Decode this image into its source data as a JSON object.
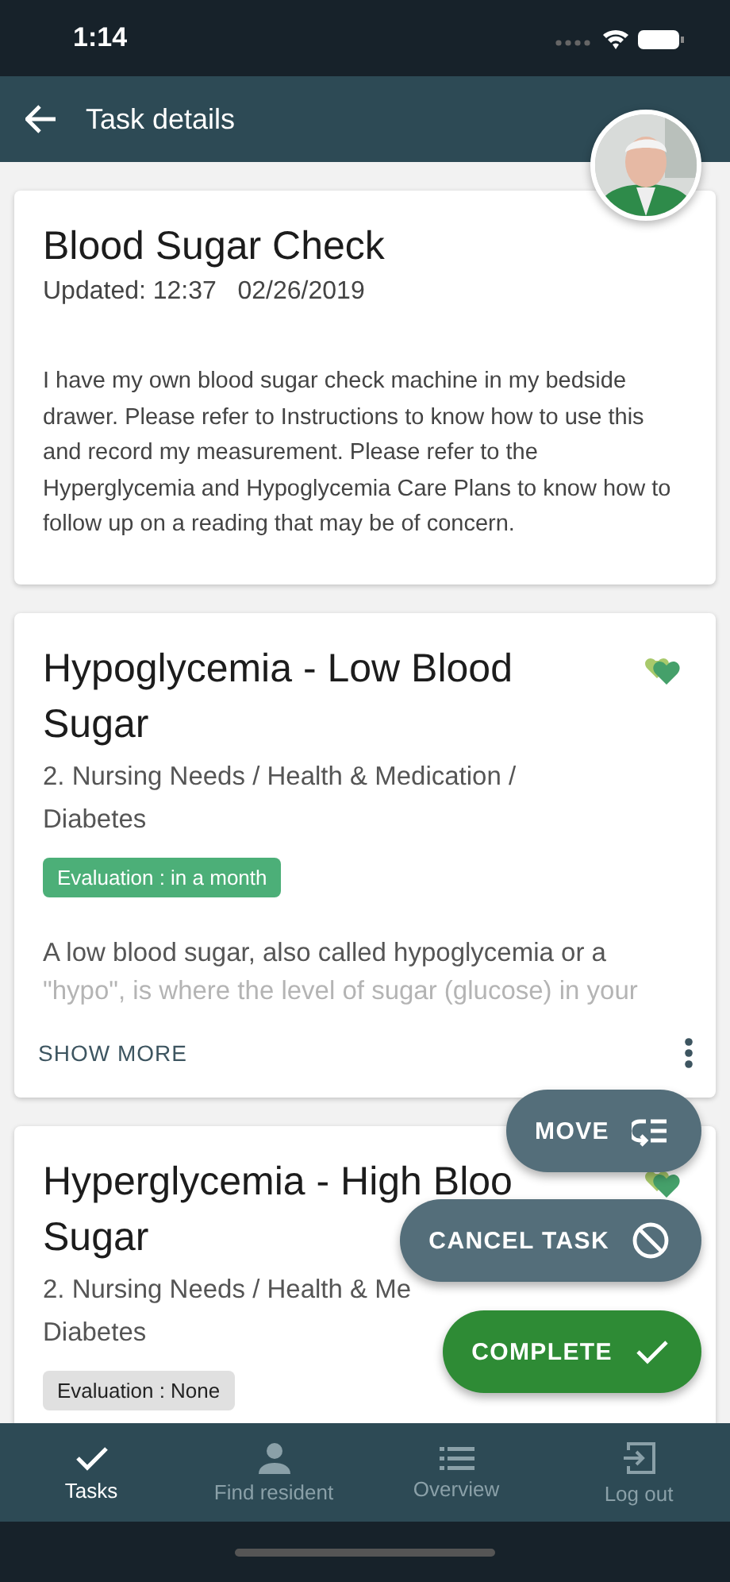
{
  "status_bar": {
    "time": "1:14"
  },
  "header": {
    "title": "Task details"
  },
  "cards": [
    {
      "title": "Blood Sugar Check",
      "updated": "Updated: 12:37   02/26/2019",
      "body": "I have my own blood sugar check machine in my bedside drawer. Please refer to Instructions to know how to use this and record my measurement. Please refer to the Hyperglycemia and Hypoglycemia Care Plans to know how to follow up on a reading that may be of concern."
    },
    {
      "title": "Hypoglycemia - Low Blood Sugar",
      "path": "2. Nursing Needs / Health & Medication / Diabetes",
      "heart": true,
      "tag": {
        "label": "Evaluation : in a month",
        "color": "#4caf78"
      },
      "body": "A low blood sugar, also called hypoglycemia or a",
      "body_faded": "\"hypo\", is where the level of sugar (glucose) in your",
      "show_more": "SHOW MORE"
    },
    {
      "title_lines": [
        "Hyperglycemia - High Bloo",
        "Sugar"
      ],
      "path_lines": [
        "2. Nursing Needs / Health & Me",
        "Diabetes"
      ],
      "heart": true,
      "tag": {
        "label": "Evaluation : None",
        "color": "#e0e0e0"
      }
    }
  ],
  "actions": [
    {
      "label": "MOVE",
      "kind": "move"
    },
    {
      "label": "CANCEL TASK",
      "kind": "cancel"
    },
    {
      "label": "COMPLETE",
      "kind": "complete"
    }
  ],
  "nav": [
    {
      "label": "Tasks",
      "kind": "tasks",
      "selected": true
    },
    {
      "label": "Find resident",
      "kind": "person",
      "selected": false
    },
    {
      "label": "Overview",
      "kind": "list",
      "selected": false
    },
    {
      "label": "Log out",
      "kind": "logout",
      "selected": false
    }
  ]
}
